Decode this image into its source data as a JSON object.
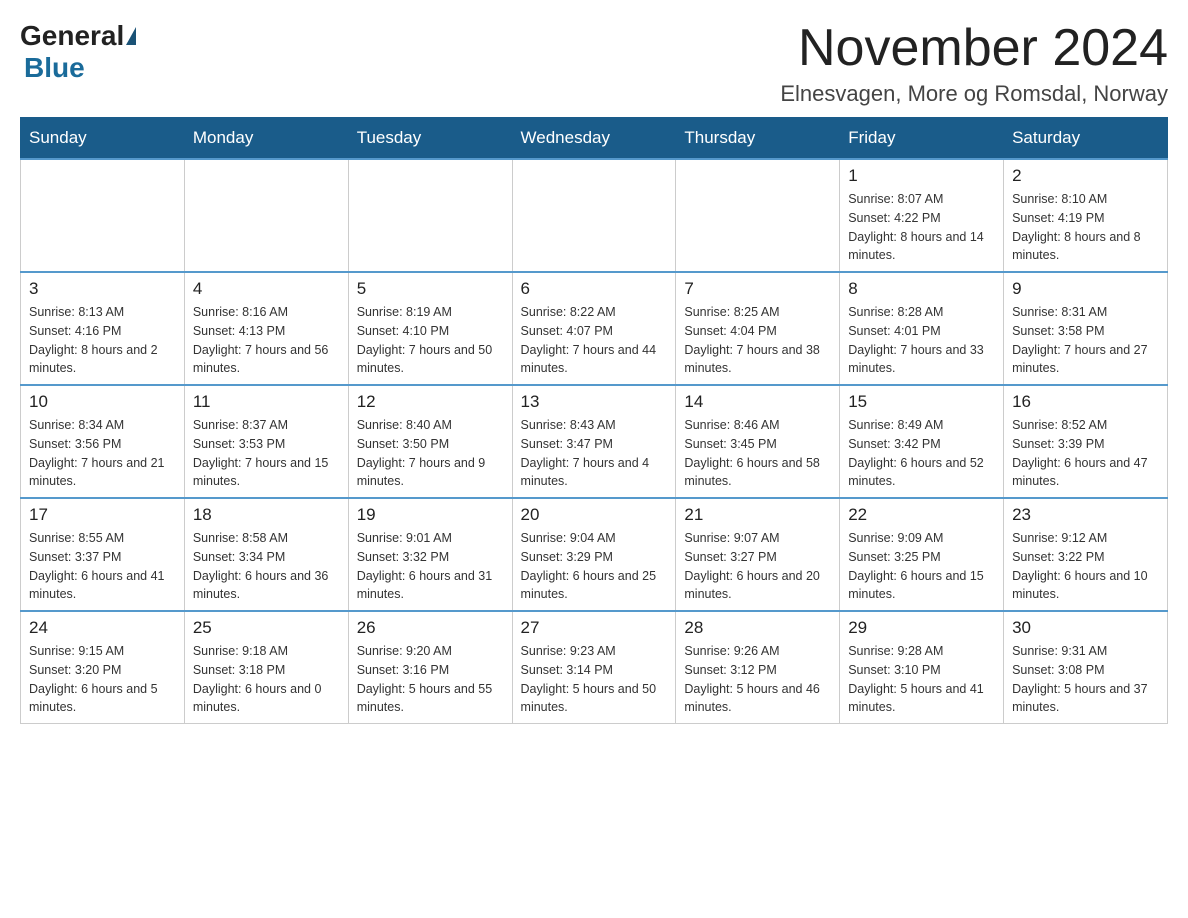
{
  "logo": {
    "general": "General",
    "blue": "Blue"
  },
  "header": {
    "month_year": "November 2024",
    "location": "Elnesvagen, More og Romsdal, Norway"
  },
  "days_of_week": [
    "Sunday",
    "Monday",
    "Tuesday",
    "Wednesday",
    "Thursday",
    "Friday",
    "Saturday"
  ],
  "weeks": [
    [
      {
        "day": "",
        "sunrise": "",
        "sunset": "",
        "daylight": ""
      },
      {
        "day": "",
        "sunrise": "",
        "sunset": "",
        "daylight": ""
      },
      {
        "day": "",
        "sunrise": "",
        "sunset": "",
        "daylight": ""
      },
      {
        "day": "",
        "sunrise": "",
        "sunset": "",
        "daylight": ""
      },
      {
        "day": "",
        "sunrise": "",
        "sunset": "",
        "daylight": ""
      },
      {
        "day": "1",
        "sunrise": "Sunrise: 8:07 AM",
        "sunset": "Sunset: 4:22 PM",
        "daylight": "Daylight: 8 hours and 14 minutes."
      },
      {
        "day": "2",
        "sunrise": "Sunrise: 8:10 AM",
        "sunset": "Sunset: 4:19 PM",
        "daylight": "Daylight: 8 hours and 8 minutes."
      }
    ],
    [
      {
        "day": "3",
        "sunrise": "Sunrise: 8:13 AM",
        "sunset": "Sunset: 4:16 PM",
        "daylight": "Daylight: 8 hours and 2 minutes."
      },
      {
        "day": "4",
        "sunrise": "Sunrise: 8:16 AM",
        "sunset": "Sunset: 4:13 PM",
        "daylight": "Daylight: 7 hours and 56 minutes."
      },
      {
        "day": "5",
        "sunrise": "Sunrise: 8:19 AM",
        "sunset": "Sunset: 4:10 PM",
        "daylight": "Daylight: 7 hours and 50 minutes."
      },
      {
        "day": "6",
        "sunrise": "Sunrise: 8:22 AM",
        "sunset": "Sunset: 4:07 PM",
        "daylight": "Daylight: 7 hours and 44 minutes."
      },
      {
        "day": "7",
        "sunrise": "Sunrise: 8:25 AM",
        "sunset": "Sunset: 4:04 PM",
        "daylight": "Daylight: 7 hours and 38 minutes."
      },
      {
        "day": "8",
        "sunrise": "Sunrise: 8:28 AM",
        "sunset": "Sunset: 4:01 PM",
        "daylight": "Daylight: 7 hours and 33 minutes."
      },
      {
        "day": "9",
        "sunrise": "Sunrise: 8:31 AM",
        "sunset": "Sunset: 3:58 PM",
        "daylight": "Daylight: 7 hours and 27 minutes."
      }
    ],
    [
      {
        "day": "10",
        "sunrise": "Sunrise: 8:34 AM",
        "sunset": "Sunset: 3:56 PM",
        "daylight": "Daylight: 7 hours and 21 minutes."
      },
      {
        "day": "11",
        "sunrise": "Sunrise: 8:37 AM",
        "sunset": "Sunset: 3:53 PM",
        "daylight": "Daylight: 7 hours and 15 minutes."
      },
      {
        "day": "12",
        "sunrise": "Sunrise: 8:40 AM",
        "sunset": "Sunset: 3:50 PM",
        "daylight": "Daylight: 7 hours and 9 minutes."
      },
      {
        "day": "13",
        "sunrise": "Sunrise: 8:43 AM",
        "sunset": "Sunset: 3:47 PM",
        "daylight": "Daylight: 7 hours and 4 minutes."
      },
      {
        "day": "14",
        "sunrise": "Sunrise: 8:46 AM",
        "sunset": "Sunset: 3:45 PM",
        "daylight": "Daylight: 6 hours and 58 minutes."
      },
      {
        "day": "15",
        "sunrise": "Sunrise: 8:49 AM",
        "sunset": "Sunset: 3:42 PM",
        "daylight": "Daylight: 6 hours and 52 minutes."
      },
      {
        "day": "16",
        "sunrise": "Sunrise: 8:52 AM",
        "sunset": "Sunset: 3:39 PM",
        "daylight": "Daylight: 6 hours and 47 minutes."
      }
    ],
    [
      {
        "day": "17",
        "sunrise": "Sunrise: 8:55 AM",
        "sunset": "Sunset: 3:37 PM",
        "daylight": "Daylight: 6 hours and 41 minutes."
      },
      {
        "day": "18",
        "sunrise": "Sunrise: 8:58 AM",
        "sunset": "Sunset: 3:34 PM",
        "daylight": "Daylight: 6 hours and 36 minutes."
      },
      {
        "day": "19",
        "sunrise": "Sunrise: 9:01 AM",
        "sunset": "Sunset: 3:32 PM",
        "daylight": "Daylight: 6 hours and 31 minutes."
      },
      {
        "day": "20",
        "sunrise": "Sunrise: 9:04 AM",
        "sunset": "Sunset: 3:29 PM",
        "daylight": "Daylight: 6 hours and 25 minutes."
      },
      {
        "day": "21",
        "sunrise": "Sunrise: 9:07 AM",
        "sunset": "Sunset: 3:27 PM",
        "daylight": "Daylight: 6 hours and 20 minutes."
      },
      {
        "day": "22",
        "sunrise": "Sunrise: 9:09 AM",
        "sunset": "Sunset: 3:25 PM",
        "daylight": "Daylight: 6 hours and 15 minutes."
      },
      {
        "day": "23",
        "sunrise": "Sunrise: 9:12 AM",
        "sunset": "Sunset: 3:22 PM",
        "daylight": "Daylight: 6 hours and 10 minutes."
      }
    ],
    [
      {
        "day": "24",
        "sunrise": "Sunrise: 9:15 AM",
        "sunset": "Sunset: 3:20 PM",
        "daylight": "Daylight: 6 hours and 5 minutes."
      },
      {
        "day": "25",
        "sunrise": "Sunrise: 9:18 AM",
        "sunset": "Sunset: 3:18 PM",
        "daylight": "Daylight: 6 hours and 0 minutes."
      },
      {
        "day": "26",
        "sunrise": "Sunrise: 9:20 AM",
        "sunset": "Sunset: 3:16 PM",
        "daylight": "Daylight: 5 hours and 55 minutes."
      },
      {
        "day": "27",
        "sunrise": "Sunrise: 9:23 AM",
        "sunset": "Sunset: 3:14 PM",
        "daylight": "Daylight: 5 hours and 50 minutes."
      },
      {
        "day": "28",
        "sunrise": "Sunrise: 9:26 AM",
        "sunset": "Sunset: 3:12 PM",
        "daylight": "Daylight: 5 hours and 46 minutes."
      },
      {
        "day": "29",
        "sunrise": "Sunrise: 9:28 AM",
        "sunset": "Sunset: 3:10 PM",
        "daylight": "Daylight: 5 hours and 41 minutes."
      },
      {
        "day": "30",
        "sunrise": "Sunrise: 9:31 AM",
        "sunset": "Sunset: 3:08 PM",
        "daylight": "Daylight: 5 hours and 37 minutes."
      }
    ]
  ]
}
